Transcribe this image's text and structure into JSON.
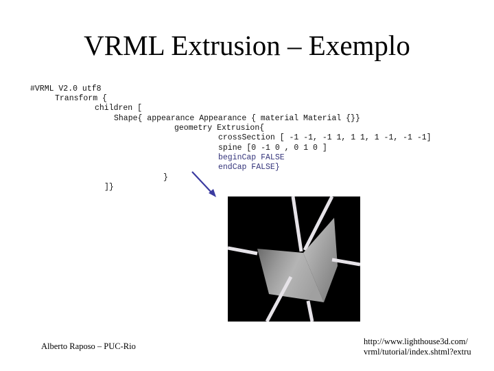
{
  "title": "VRML Extrusion – Exemplo",
  "code_lines": [
    "#VRML V2.0 utf8",
    "Transform {",
    "children [",
    "Shape{ appearance Appearance { material Material {}}",
    "geometry Extrusion{",
    "crossSection [ -1 -1, -1 1, 1 1, 1 -1, -1 -1]",
    "spine [0 -1 0 , 0 1 0 ]",
    "beginCap FALSE",
    "endCap FALSE}",
    "}",
    "]}"
  ],
  "highlight_color": "#33337a",
  "arrow_color": "#3a3aa0",
  "footer": {
    "author": "Alberto Raposo – PUC-Rio",
    "url_line1": "http://www.lighthouse3d.com/",
    "url_line2": "vrml/tutorial/index.shtml?extru"
  }
}
